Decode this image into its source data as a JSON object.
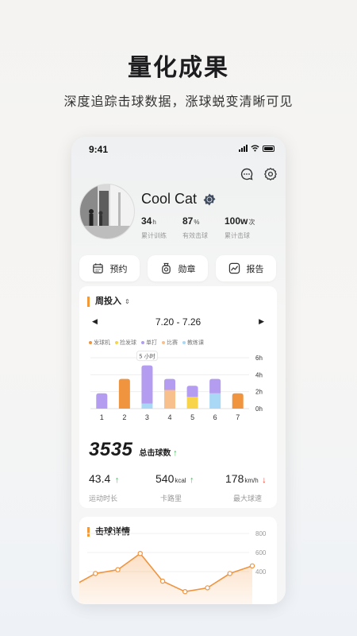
{
  "hero": {
    "title": "量化成果",
    "subtitle": "深度追踪击球数据，涨球蜕变清晰可见"
  },
  "status_bar": {
    "time": "9:41"
  },
  "header_icons": [
    "chat-bubble-icon",
    "gear-icon"
  ],
  "profile": {
    "name": "Cool Cat",
    "stats": [
      {
        "value": "34",
        "unit": "h",
        "label": "累计训练"
      },
      {
        "value": "87",
        "unit": "%",
        "label": "有效击球"
      },
      {
        "value": "100w",
        "unit": "次",
        "label": "累计击球"
      }
    ]
  },
  "actions": [
    {
      "label": "预约",
      "icon": "calendar-icon"
    },
    {
      "label": "勋章",
      "icon": "medal-icon"
    },
    {
      "label": "报告",
      "icon": "trend-chart-icon"
    }
  ],
  "weekly_card": {
    "title": "周投入",
    "sort_glyph": "⇕",
    "range": "7.20 - 7.26",
    "prev_arrow": "◀",
    "next_arrow": "▶",
    "legend": [
      {
        "name": "发球机",
        "color": "#f0943f"
      },
      {
        "name": "捡发球",
        "color": "#f7d44a"
      },
      {
        "name": "单打",
        "color": "#b49cf0"
      },
      {
        "name": "比赛",
        "color": "#f8c08c"
      },
      {
        "name": "教练课",
        "color": "#a9d8f7"
      }
    ],
    "total": {
      "value": "3535",
      "label": "总击球数",
      "trend": "↑"
    },
    "metrics": [
      {
        "value": "43.4",
        "unit": "",
        "label": "运动时长",
        "trend": "↑"
      },
      {
        "value": "540",
        "unit": "kcal",
        "label": "卡路里",
        "trend": "↑"
      },
      {
        "value": "178",
        "unit": "km/h",
        "label": "最大球速",
        "trend": "↓"
      }
    ]
  },
  "chart_data": [
    {
      "type": "bar",
      "stacked": true,
      "categories": [
        "1",
        "2",
        "3",
        "4",
        "5",
        "6",
        "7"
      ],
      "y_ticks": [
        "6h",
        "4h",
        "2h",
        "0h"
      ],
      "ylim": [
        0,
        6
      ],
      "tooltip": {
        "category": "3",
        "text": "5 小时"
      },
      "series": [
        {
          "name": "发球机",
          "color": "#f0943f",
          "values": [
            0,
            3.5,
            0,
            0,
            0,
            0,
            1.8
          ]
        },
        {
          "name": "捡发球",
          "color": "#f7d44a",
          "values": [
            0,
            0,
            0,
            0,
            1.4,
            0,
            0
          ]
        },
        {
          "name": "单打",
          "color": "#b49cf0",
          "values": [
            1.8,
            0,
            4.5,
            1.3,
            1.3,
            1.7,
            0
          ]
        },
        {
          "name": "比赛",
          "color": "#f8c08c",
          "values": [
            0,
            0,
            0,
            2.2,
            0,
            0,
            0
          ]
        },
        {
          "name": "教练课",
          "color": "#a9d8f7",
          "values": [
            0,
            0,
            0.6,
            0,
            0,
            1.8,
            0
          ]
        }
      ]
    },
    {
      "type": "area",
      "y_ticks": [
        "800",
        "600",
        "400"
      ],
      "ylim": [
        0,
        800
      ],
      "values": [
        250,
        380,
        420,
        590,
        300,
        190,
        230,
        380,
        460
      ]
    }
  ],
  "detail_card": {
    "title": "击球详情"
  }
}
